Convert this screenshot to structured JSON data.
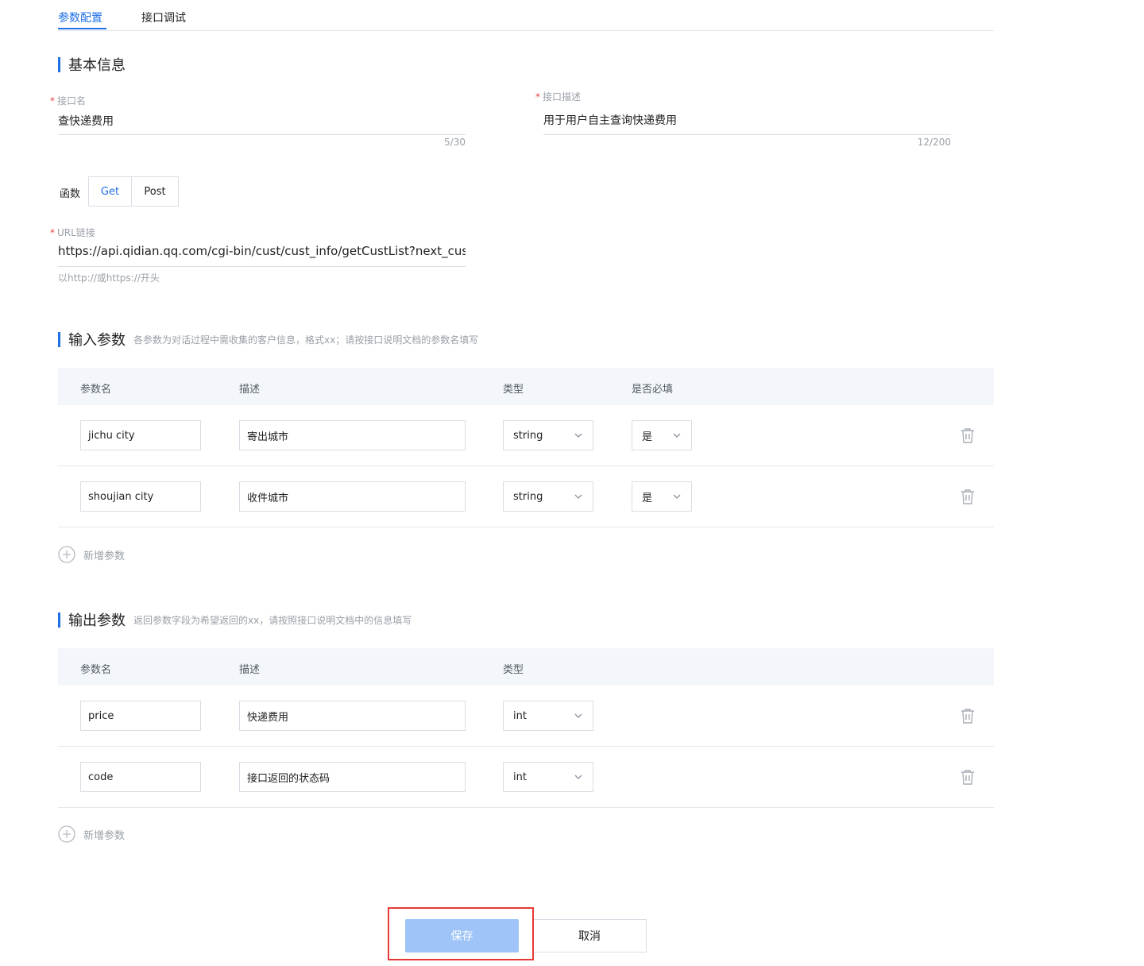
{
  "tabs": [
    {
      "label": "参数配置",
      "active": true
    },
    {
      "label": "接口调试",
      "active": false
    }
  ],
  "basic": {
    "title": "基本信息",
    "name_label": "接口名",
    "name_value": "查快递费用",
    "name_count": "5/30",
    "desc_label": "接口描述",
    "desc_value": "用于用户自主查询快递费用",
    "desc_count": "12/200",
    "func_label": "函数",
    "func_options": [
      "Get",
      "Post"
    ],
    "func_selected": "Get",
    "url_label": "URL链接",
    "url_value": "https://api.qidian.qq.com/cgi-bin/cust/cust_info/getCustList?next_custi",
    "url_hint": "以http://或https://开头"
  },
  "input_params": {
    "title": "输入参数",
    "hint": "各参数为对话过程中需收集的客户信息，格式xx；请按接口说明文档的参数名填写",
    "headers": [
      "参数名",
      "描述",
      "类型",
      "是否必填"
    ],
    "rows": [
      {
        "name": "jichu city",
        "desc": "寄出城市",
        "type": "string",
        "required": "是"
      },
      {
        "name": "shoujian city",
        "desc": "收件城市",
        "type": "string",
        "required": "是"
      }
    ],
    "add_label": "新增参数"
  },
  "output_params": {
    "title": "输出参数",
    "hint": "返回参数字段为希望返回的xx，请按照接口说明文档中的信息填写",
    "headers": [
      "参数名",
      "描述",
      "类型"
    ],
    "rows": [
      {
        "name": "price",
        "desc": "快递费用",
        "type": "int"
      },
      {
        "name": "code",
        "desc": "接口返回的状态码",
        "type": "int"
      }
    ],
    "add_label": "新增参数"
  },
  "actions": {
    "save_label": "保存",
    "cancel_label": "取消"
  },
  "colors": {
    "accent": "#1f6fe5",
    "save_disabled": "#9fc4f7",
    "highlight": "#e53935",
    "required": "#e54545"
  }
}
